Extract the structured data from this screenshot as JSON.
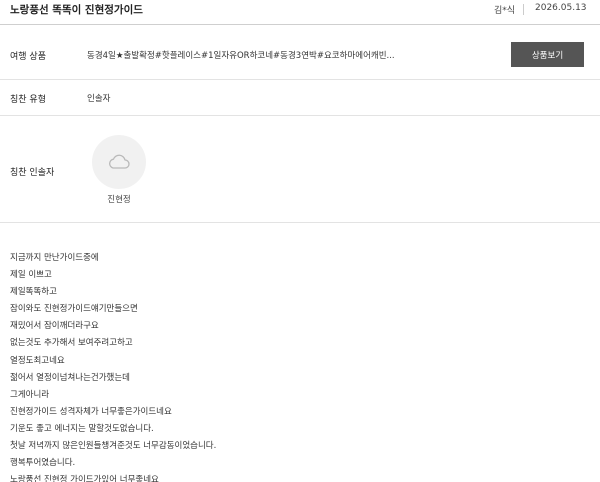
{
  "review": {
    "title": "노랑풍선 똑똑이 진현정가이드",
    "author": "김*식",
    "date": "2026.05.13"
  },
  "travel_product": {
    "label": "여행 상품",
    "value": "동경4일★출발확정#핫플레이스#1일자유OR하코네#동경3연박#요코하마에어캐빈...",
    "button_label": "상품보기"
  },
  "praise_type": {
    "label": "칭찬 유형",
    "value": "인솔자"
  },
  "praise_guide": {
    "label": "칭찬 인솔자",
    "name": "진현정",
    "avatar_icon": "cloud-icon"
  },
  "body": {
    "lines": [
      "지금까지 만난가이드중에",
      "제일 이쁘고",
      "제일똑똑하고",
      "잠이와도 진현정가이드얘기만들으면",
      "재밌어서 잠이깨더라구요",
      "없는것도 추가해서 보여주려고하고",
      "열정도최고네요",
      "젊어서 열정이넘쳐나는건가했는데",
      "그게아니라",
      "진현정가이드 성격자체가 너무좋은가이드네요",
      "기운도 좋고 에너지는 말할것도없습니다.",
      "첫날 저녁까지 많은인원들챙겨준것도 너무감동이었습니다.",
      "행복투어였습니다.",
      "노랑풍선 진현정 가이드가있어 너무좋네요"
    ]
  }
}
